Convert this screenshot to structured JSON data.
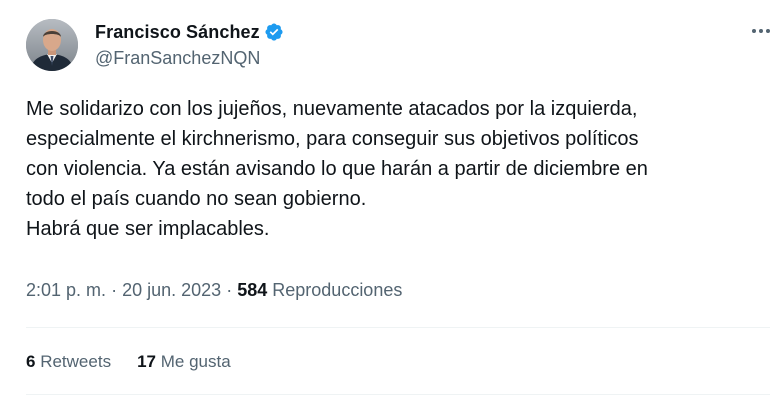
{
  "author": {
    "display_name": "Francisco Sánchez",
    "handle": "@FranSanchezNQN",
    "verified": true,
    "avatar_icon": "avatar-photo"
  },
  "tweet": {
    "lines": [
      "Me solidarizo con los jujeños, nuevamente atacados por la izquierda,",
      "especialmente el kirchnerismo, para conseguir sus objetivos políticos",
      "con violencia. Ya están avisando lo que harán a partir de diciembre en",
      "todo el país cuando no sean gobierno.",
      "Habrá que ser implacables."
    ]
  },
  "meta": {
    "time": "2:01 p. m.",
    "separator": "·",
    "date": "20 jun. 2023",
    "views_count": "584",
    "views_label": "Reproducciones"
  },
  "stats": {
    "retweets_count": "6",
    "retweets_label": "Retweets",
    "likes_count": "17",
    "likes_label": "Me gusta"
  },
  "colors": {
    "verified_blue": "#1d9bf0",
    "secondary_text": "#536471",
    "primary_text": "#0f1419",
    "divider": "#eff3f4"
  }
}
